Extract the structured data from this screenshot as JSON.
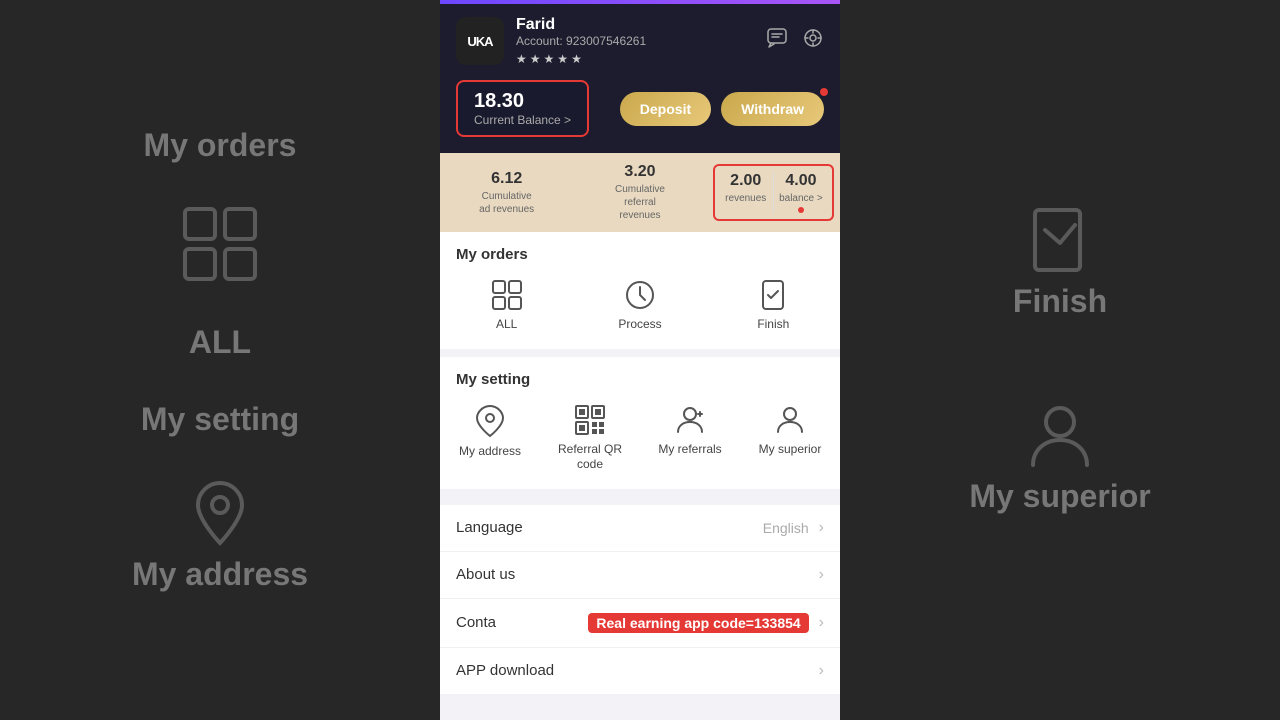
{
  "background": {
    "left": {
      "sections": [
        {
          "label": "My orders",
          "icon": "⊞"
        },
        {
          "label": "ALL",
          "icon": ""
        },
        {
          "label": "My setting",
          "icon": ""
        },
        {
          "label": "My address",
          "icon": ""
        }
      ]
    },
    "right": {
      "sections": [
        {
          "label": "Finish",
          "icon": ""
        },
        {
          "label": "My superior",
          "icon": ""
        }
      ]
    }
  },
  "header": {
    "gradient_bar": true,
    "avatar_text": "UKA",
    "user_name": "Farid",
    "account_label": "Account:",
    "account_number": "923007546261",
    "stars_count": 5,
    "icons": [
      "chat",
      "scan"
    ],
    "balance": {
      "amount": "18.30",
      "label": "Current Balance >",
      "border_color": "#e53935"
    },
    "deposit_btn": "Deposit",
    "withdraw_btn": "Withdraw"
  },
  "stats": [
    {
      "value": "6.12",
      "label": "Cumulative\nad revenues",
      "highlighted": false
    },
    {
      "value": "3.20",
      "label": "Cumulative\nreferral\nrevenues",
      "highlighted": false
    },
    {
      "value": "2.00",
      "label": "revenues",
      "highlighted": true
    },
    {
      "value": "4.00",
      "label": "balance >",
      "highlighted": true
    }
  ],
  "my_orders": {
    "section_title": "My orders",
    "items": [
      {
        "id": "all",
        "label": "ALL"
      },
      {
        "id": "process",
        "label": "Process"
      },
      {
        "id": "finish",
        "label": "Finish"
      }
    ]
  },
  "my_setting": {
    "section_title": "My setting",
    "items": [
      {
        "id": "address",
        "label": "My address"
      },
      {
        "id": "qr",
        "label": "Referral QR\ncode"
      },
      {
        "id": "referrals",
        "label": "My referrals"
      },
      {
        "id": "superior",
        "label": "My superior"
      }
    ]
  },
  "menu_items": [
    {
      "id": "language",
      "label": "Language",
      "value": "English",
      "has_arrow": true
    },
    {
      "id": "about",
      "label": "About us",
      "value": "",
      "has_arrow": true
    },
    {
      "id": "contact",
      "label": "Conta",
      "highlight_text": "Real earning app code=133854",
      "has_arrow": true
    },
    {
      "id": "download",
      "label": "APP download",
      "value": "",
      "has_arrow": true
    }
  ]
}
